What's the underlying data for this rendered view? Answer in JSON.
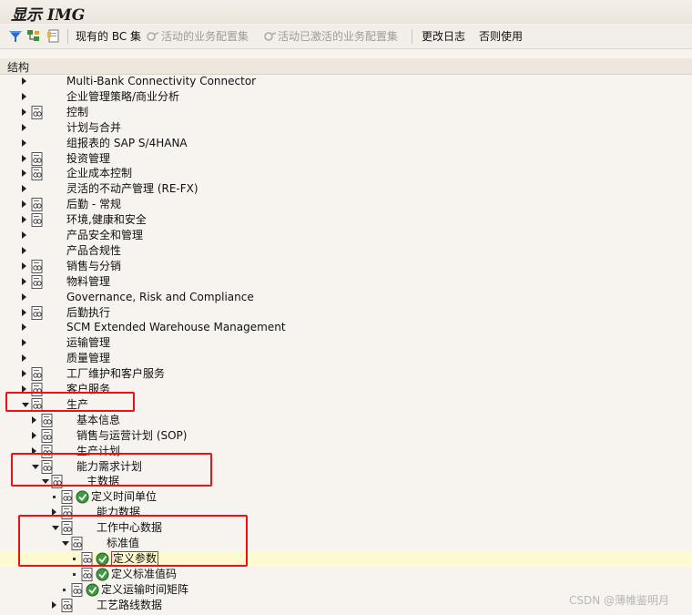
{
  "window": {
    "title": "显示 IMG"
  },
  "toolbar": {
    "current_bc": "现有的 BC 集",
    "active_bc": "活动的业务配置集",
    "activated_bc": "活动已激活的业务配置集",
    "change_log": "更改日志",
    "otherwise": "否则使用"
  },
  "structure": {
    "label": "结构"
  },
  "tree": [
    {
      "label": "Multi-Bank Connectivity Connector",
      "level": 0,
      "toggle": "closed",
      "doc": false,
      "exec": false
    },
    {
      "label": "企业管理策略/商业分析",
      "level": 0,
      "toggle": "closed",
      "doc": false,
      "exec": false
    },
    {
      "label": "控制",
      "level": 0,
      "toggle": "closed",
      "doc": true,
      "exec": false
    },
    {
      "label": "计划与合并",
      "level": 0,
      "toggle": "closed",
      "doc": false,
      "exec": false
    },
    {
      "label": "组报表的 SAP S/4HANA",
      "level": 0,
      "toggle": "closed",
      "doc": false,
      "exec": false
    },
    {
      "label": "投资管理",
      "level": 0,
      "toggle": "closed",
      "doc": true,
      "exec": false
    },
    {
      "label": "企业成本控制",
      "level": 0,
      "toggle": "closed",
      "doc": true,
      "exec": false
    },
    {
      "label": "灵活的不动产管理 (RE-FX)",
      "level": 0,
      "toggle": "closed",
      "doc": false,
      "exec": false
    },
    {
      "label": "后勤 - 常规",
      "level": 0,
      "toggle": "closed",
      "doc": true,
      "exec": false
    },
    {
      "label": "环境,健康和安全",
      "level": 0,
      "toggle": "closed",
      "doc": true,
      "exec": false
    },
    {
      "label": "产品安全和管理",
      "level": 0,
      "toggle": "closed",
      "doc": false,
      "exec": false
    },
    {
      "label": "产品合规性",
      "level": 0,
      "toggle": "closed",
      "doc": false,
      "exec": false
    },
    {
      "label": "销售与分销",
      "level": 0,
      "toggle": "closed",
      "doc": true,
      "exec": false
    },
    {
      "label": "物料管理",
      "level": 0,
      "toggle": "closed",
      "doc": true,
      "exec": false
    },
    {
      "label": "Governance, Risk and Compliance",
      "level": 0,
      "toggle": "closed",
      "doc": false,
      "exec": false
    },
    {
      "label": "后勤执行",
      "level": 0,
      "toggle": "closed",
      "doc": true,
      "exec": false
    },
    {
      "label": "SCM Extended Warehouse Management",
      "level": 0,
      "toggle": "closed",
      "doc": false,
      "exec": false
    },
    {
      "label": "运输管理",
      "level": 0,
      "toggle": "closed",
      "doc": false,
      "exec": false
    },
    {
      "label": "质量管理",
      "level": 0,
      "toggle": "closed",
      "doc": false,
      "exec": false
    },
    {
      "label": "工厂维护和客户服务",
      "level": 0,
      "toggle": "closed",
      "doc": true,
      "exec": false
    },
    {
      "label": "客户服务",
      "level": 0,
      "toggle": "closed",
      "doc": true,
      "exec": false
    },
    {
      "label": "生产",
      "level": 0,
      "toggle": "open",
      "doc": true,
      "exec": false
    },
    {
      "label": "基本信息",
      "level": 1,
      "toggle": "closed",
      "doc": true,
      "exec": false
    },
    {
      "label": "销售与运营计划 (SOP)",
      "level": 1,
      "toggle": "closed",
      "doc": true,
      "exec": false
    },
    {
      "label": "生产计划",
      "level": 1,
      "toggle": "closed",
      "doc": true,
      "exec": false
    },
    {
      "label": "能力需求计划",
      "level": 1,
      "toggle": "open",
      "doc": true,
      "exec": false
    },
    {
      "label": "主数据",
      "level": 2,
      "toggle": "open",
      "doc": true,
      "exec": false
    },
    {
      "label": "定义时间单位",
      "level": 3,
      "toggle": "bullet",
      "doc": true,
      "exec": true
    },
    {
      "label": "能力数据",
      "level": 3,
      "toggle": "closed",
      "doc": true,
      "exec": false
    },
    {
      "label": "工作中心数据",
      "level": 3,
      "toggle": "open",
      "doc": true,
      "exec": false
    },
    {
      "label": "标准值",
      "level": 4,
      "toggle": "open",
      "doc": true,
      "exec": false
    },
    {
      "label": "定义参数",
      "level": 5,
      "toggle": "bullet",
      "doc": true,
      "exec": true,
      "selected": true
    },
    {
      "label": "定义标准值码",
      "level": 5,
      "toggle": "bullet",
      "doc": true,
      "exec": true
    },
    {
      "label": "定义运输时间矩阵",
      "level": 4,
      "toggle": "bullet",
      "doc": true,
      "exec": true
    },
    {
      "label": "工艺路线数据",
      "level": 3,
      "toggle": "closed",
      "doc": true,
      "exec": false
    }
  ],
  "watermark": "CSDN @薄帷鉴明月",
  "colors": {
    "selected_row": "#fdfad0",
    "highlight_box": "#ee1111"
  }
}
